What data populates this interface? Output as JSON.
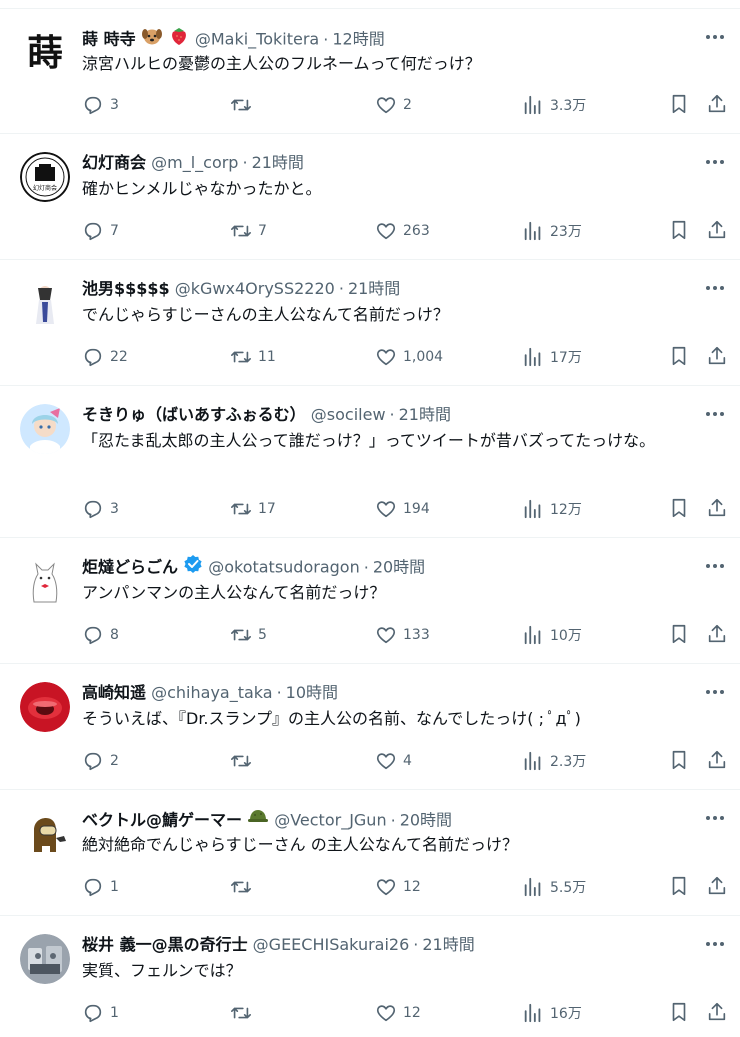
{
  "icons": {
    "reply": "reply-icon",
    "retweet": "retweet-icon",
    "like": "like-icon",
    "views": "views-icon",
    "bookmark": "bookmark-icon",
    "share": "share-icon",
    "more": "more-icon"
  },
  "colors": {
    "text": "#0f1419",
    "secondary": "#536471",
    "verified": "#1d9bf0",
    "divider": "#eff3f4"
  },
  "tweets": [
    {
      "name": "蒔 時寺",
      "emoji": [
        "dog-face-emoji",
        "strawberry-emoji"
      ],
      "handle": "@Maki_Tokitera",
      "sep": "·",
      "time": "12時間",
      "text": "涼宮ハルヒの憂鬱の主人公のフルネームって何だっけ？",
      "replies": "3",
      "retweets": "",
      "likes": "2",
      "views": "3.3万"
    },
    {
      "name": "幻灯商会",
      "handle": "@m_l_corp",
      "sep": "·",
      "time": "21時間",
      "text": "確かヒンメルじゃなかったかと。",
      "replies": "7",
      "retweets": "7",
      "likes": "263",
      "views": "23万"
    },
    {
      "name": "池男$$$$$",
      "handle": "@kGwx4OrySS2220",
      "sep": "·",
      "time": "21時間",
      "text": "でんじゃらすじーさんの主人公なんて名前だっけ？",
      "replies": "22",
      "retweets": "11",
      "likes": "1,004",
      "views": "17万"
    },
    {
      "name": "そきりゅ（ばいあすふぉるむ）",
      "handle": "@socilew",
      "sep": "·",
      "time": "21時間",
      "text": "「忍たま乱太郎の主人公って誰だっけ？」ってツイートが昔バズってたっけな。",
      "replies": "3",
      "retweets": "17",
      "likes": "194",
      "views": "12万"
    },
    {
      "name": "炬燵どらごん",
      "verified": true,
      "handle": "@okotatsudoragon",
      "sep": "·",
      "time": "20時間",
      "text": "アンパンマンの主人公なんて名前だっけ？",
      "replies": "8",
      "retweets": "5",
      "likes": "133",
      "views": "10万"
    },
    {
      "name": "高崎知遥",
      "handle": "@chihaya_taka",
      "sep": "·",
      "time": "10時間",
      "text": "そういえば、『Dr.スランプ』の主人公の名前、なんでしたっけ( ; ﾟдﾟ)",
      "replies": "2",
      "retweets": "",
      "likes": "4",
      "views": "2.3万"
    },
    {
      "name": "ベクトル@鯖ゲーマー",
      "emoji": [
        "helmet-emoji"
      ],
      "handle": "@Vector_JGun",
      "sep": "·",
      "time": "20時間",
      "text": "絶対絶命でんじゃらすじーさん の主人公なんて名前だっけ？",
      "replies": "1",
      "retweets": "",
      "likes": "12",
      "views": "5.5万"
    },
    {
      "name": "桜井 義一@黒の奇行士",
      "handle": "@GEECHISakurai26",
      "sep": "·",
      "time": "21時間",
      "text": "実質、フェルンでは？",
      "replies": "1",
      "retweets": "",
      "likes": "12",
      "views": "16万"
    }
  ]
}
